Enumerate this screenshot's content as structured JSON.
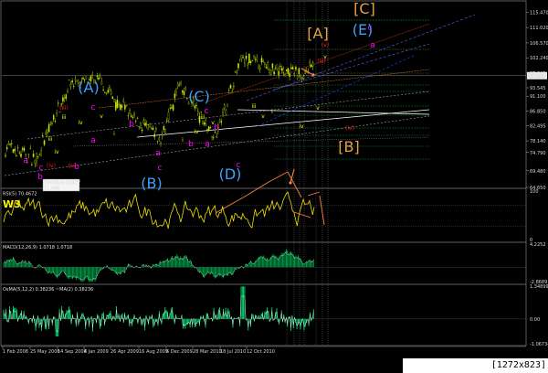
{
  "colors": {
    "background": "#000000",
    "candle": "#c8e600",
    "rsi": "#f0e000",
    "macd_bar": "#00a04a",
    "macd_signal": "#ffffff",
    "osma": "#00ff80",
    "wave_blue": "#3aa0ff",
    "wave_orange": "#e8a040",
    "wave_magenta": "#ff00ff",
    "wave_red": "#ff2020",
    "arrow": "#ff8040"
  },
  "chart_data": [
    {
      "type": "candlestick",
      "panel": "price",
      "ylim": [
        64.65,
        118.475
      ],
      "price_ticks": [
        "115.470",
        "111.020",
        "106.570",
        "102.240",
        "97.845",
        "93.545",
        "91.100",
        "86.850",
        "82.495",
        "78.140",
        "74.790",
        "69.480",
        "64.650"
      ],
      "current_price": "97.060",
      "trendline_label": [
        "Trendline 50427",
        "71.496"
      ],
      "series": [
        {
          "name": "price",
          "x": [
            "1 Feb 2008",
            "25 May 2008",
            "14 Sep 2008",
            "4 Jan 2009",
            "26 Apr 2009",
            "16 Aug 2009",
            "6 Dec 2009",
            "28 Mar 2010",
            "18 Jul 2010",
            "7 Nov 2010",
            "27 Feb 2011"
          ],
          "y": [
            76.2,
            72.9,
            94.3,
            95.6,
            84.7,
            78.4,
            94.3,
            79.4,
            101.7,
            97.2,
            99.3
          ]
        }
      ],
      "wave_labels": [
        {
          "text": "(A)",
          "color": "#3aa0ff"
        },
        {
          "text": "(B)",
          "color": "#3aa0ff"
        },
        {
          "text": "(C)",
          "color": "#3aa0ff"
        },
        {
          "text": "(D)",
          "color": "#3aa0ff"
        },
        {
          "text": "(E)",
          "color": "#3aa0ff"
        },
        {
          "text": "[A]",
          "color": "#e8a040"
        },
        {
          "text": "[B]",
          "color": "#e8a040"
        },
        {
          "text": "[C]",
          "color": "#e8a040"
        },
        {
          "text": "a",
          "color": "#ff00ff"
        },
        {
          "text": "b",
          "color": "#ff00ff"
        },
        {
          "text": "c",
          "color": "#ff00ff"
        },
        {
          "text": "(iii)",
          "color": "#ff2020"
        },
        {
          "text": "(iv)",
          "color": "#ff2020"
        },
        {
          "text": "(v)",
          "color": "#ff2020"
        },
        {
          "text": "iii",
          "color": "#ffff00"
        },
        {
          "text": "iv",
          "color": "#ffff00"
        },
        {
          "text": "v",
          "color": "#ffff00"
        },
        {
          "text": "i",
          "color": "#ffff00"
        }
      ]
    },
    {
      "type": "line",
      "panel": "rsi",
      "title": "RSI(5) 70.4672",
      "annotation": "W3",
      "ylim": [
        0,
        100
      ],
      "ticks": [
        "100",
        "0"
      ],
      "series": [
        {
          "name": "RSI(5)",
          "last": 70.4672
        }
      ]
    },
    {
      "type": "bar",
      "panel": "macd",
      "title": "MACD(12,26,9) 1.0718 1.0718",
      "ylim": [
        -2.8689,
        4.2252
      ],
      "ticks": [
        "4.2252",
        "-2.8689"
      ],
      "series": [
        {
          "name": "MACD(12,26,9)",
          "last": 1.0718
        }
      ]
    },
    {
      "type": "bar",
      "panel": "osma",
      "title": "OsMA(5,12,2) 0.38236 ~MA(2) 0.38236",
      "ylim": [
        -1.06734,
        1.34899
      ],
      "ticks": [
        "1.34899",
        "0.00",
        "-1.06734"
      ],
      "series": [
        {
          "name": "OsMA(5,12,2)",
          "last": 0.38236
        }
      ]
    }
  ],
  "x_ticks": [
    "1 Feb 2008",
    "25 May 2008",
    "14 Sep 2008",
    "4 Jan 2009",
    "26 Apr 2009",
    "16 Aug 2009",
    "6 Dec 2009",
    "28 Mar 2010",
    "18 Jul 2010",
    "12 Oct 2010"
  ],
  "watermark": "[1272x823] https://upic.me/"
}
